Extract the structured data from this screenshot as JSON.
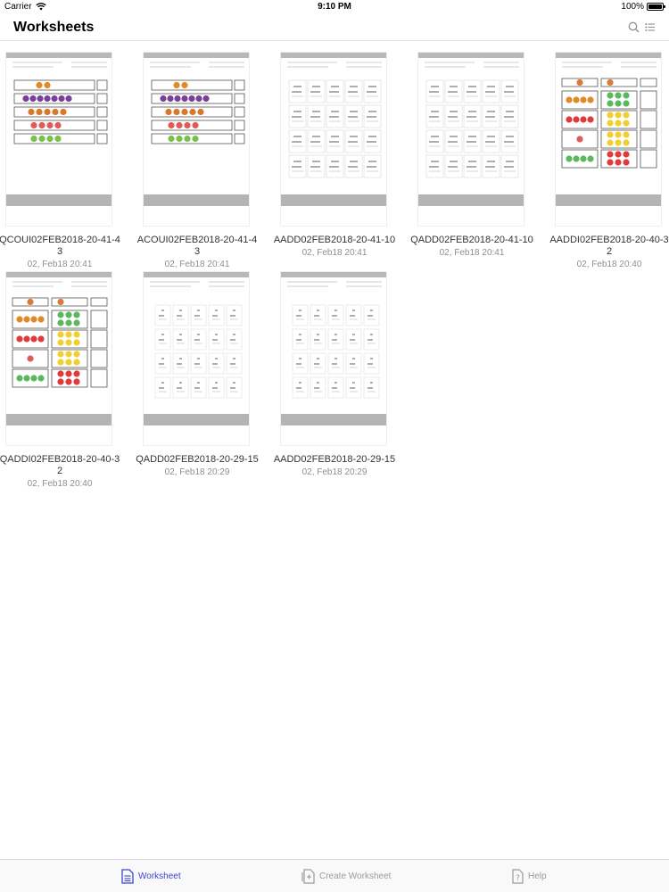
{
  "status_bar": {
    "carrier": "Carrier",
    "time": "9:10 PM",
    "battery": "100%",
    "battery_level": 1.0
  },
  "nav": {
    "title": "Worksheets"
  },
  "worksheets": [
    {
      "name": "QCOUI02FEB2018-20-41-43",
      "date": "02, Feb18 20:41",
      "kind": "count"
    },
    {
      "name": "ACOUI02FEB2018-20-41-43",
      "date": "02, Feb18 20:41",
      "kind": "count"
    },
    {
      "name": "AADD02FEB2018-20-41-10",
      "date": "02, Feb18 20:41",
      "kind": "numgrid"
    },
    {
      "name": "QADD02FEB2018-20-41-10",
      "date": "02, Feb18 20:41",
      "kind": "numgrid"
    },
    {
      "name": "AADDI02FEB2018-20-40-32",
      "date": "02, Feb18 20:40",
      "kind": "picadd"
    },
    {
      "name": "QADDI02FEB2018-20-40-32",
      "date": "02, Feb18 20:40",
      "kind": "picadd"
    },
    {
      "name": "QADD02FEB2018-20-29-15",
      "date": "02, Feb18 20:29",
      "kind": "smallgrid"
    },
    {
      "name": "AADD02FEB2018-20-29-15",
      "date": "02, Feb18 20:29",
      "kind": "smallgrid"
    }
  ],
  "tabs": [
    {
      "label": "Worksheet",
      "icon": "document-icon",
      "active": true
    },
    {
      "label": "Create Worksheet",
      "icon": "create-document-icon",
      "active": false
    },
    {
      "label": "Help",
      "icon": "help-icon",
      "active": false
    }
  ],
  "colors": {
    "accent": "#3b44c8",
    "inactive": "#9b9b9b",
    "band": "#b4b4b4"
  }
}
